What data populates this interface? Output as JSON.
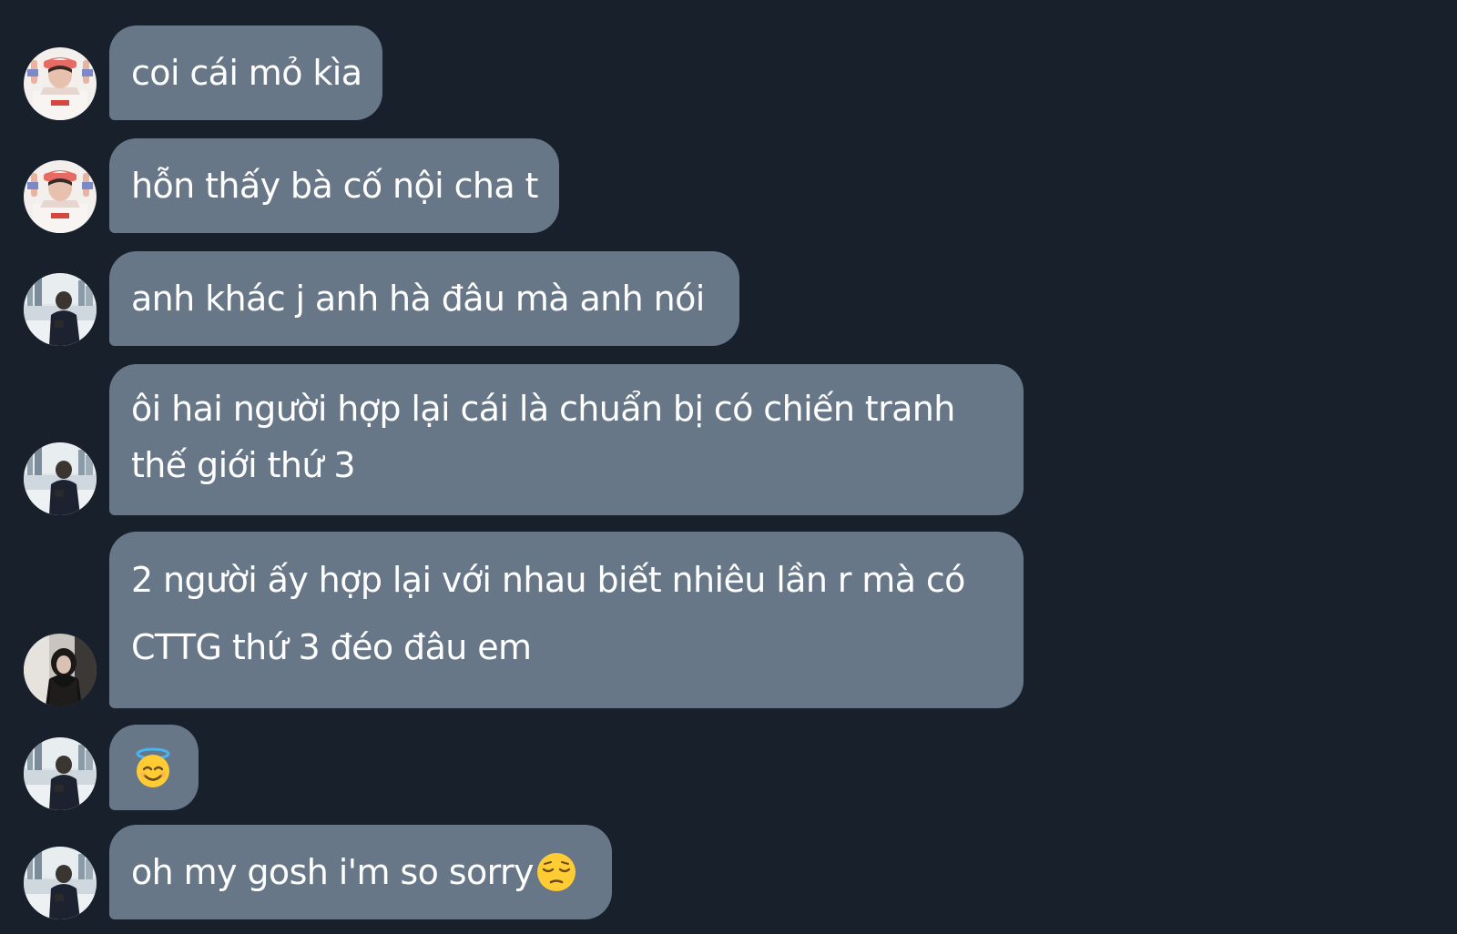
{
  "messages": [
    {
      "sender": "user-a",
      "text": "coi cái mỏ kìa"
    },
    {
      "sender": "user-a",
      "text": "hỗn thấy bà cố nội cha t"
    },
    {
      "sender": "user-b",
      "text": "anh khác j anh hà đâu mà anh nói"
    },
    {
      "sender": "user-b",
      "lines": [
        "ôi hai người hợp lại cái là chuẩn bị có chiến tranh",
        "thế giới thứ 3"
      ]
    },
    {
      "sender": "user-c",
      "lines": [
        "2 người ấy hợp lại với nhau biết nhiêu lần r mà có",
        "CTTG thứ 3 đéo đâu em"
      ]
    },
    {
      "sender": "user-b",
      "emoji": "smiling-face-with-halo"
    },
    {
      "sender": "user-b",
      "text": "oh my gosh i'm so sorry",
      "emoji": "pensive-face"
    }
  ],
  "colors": {
    "background": "#17202b",
    "bubble": "#677788",
    "text": "#ffffff"
  }
}
